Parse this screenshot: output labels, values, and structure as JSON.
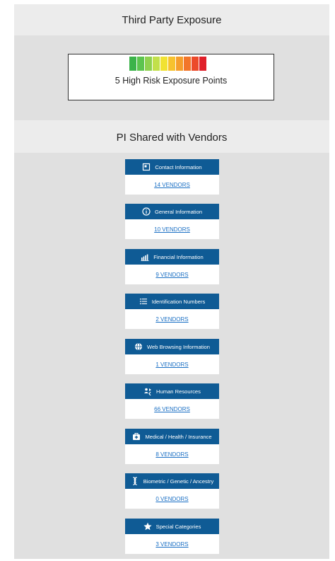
{
  "exposure": {
    "title": "Third Party Exposure",
    "label": "5 High Risk Exposure Points",
    "gauge_colors": [
      "#3bb34a",
      "#5cc44f",
      "#8fd14f",
      "#c2e04b",
      "#f1e232",
      "#f7c22e",
      "#f59e2c",
      "#f2762a",
      "#ec4a2a",
      "#e0202a"
    ]
  },
  "pi": {
    "title": "PI Shared with Vendors",
    "items": [
      {
        "icon": "contact-card-icon",
        "label": "Contact Information",
        "link": "14 VENDORS"
      },
      {
        "icon": "info-icon",
        "label": "General Information",
        "link": "10 VENDORS"
      },
      {
        "icon": "bank-chart-icon",
        "label": "Financial Information",
        "link": "9 VENDORS"
      },
      {
        "icon": "list-icon",
        "label": "Identification Numbers",
        "link": "2 VENDORS"
      },
      {
        "icon": "globe-icon",
        "label": "Web Browsing Information",
        "link": "1 VENDORS"
      },
      {
        "icon": "people-swap-icon",
        "label": "Human Resources",
        "link": "66 VENDORS"
      },
      {
        "icon": "medical-kit-icon",
        "label": "Medical / Health / Insurance",
        "link": "8 VENDORS"
      },
      {
        "icon": "dna-icon",
        "label": "Biometric / Genetic / Ancestry",
        "link": "0 VENDORS"
      },
      {
        "icon": "star-icon",
        "label": "Special Categories",
        "link": "3 VENDORS"
      }
    ]
  },
  "colors": {
    "card_header": "#0f5b95",
    "link": "#1a6fc4"
  }
}
